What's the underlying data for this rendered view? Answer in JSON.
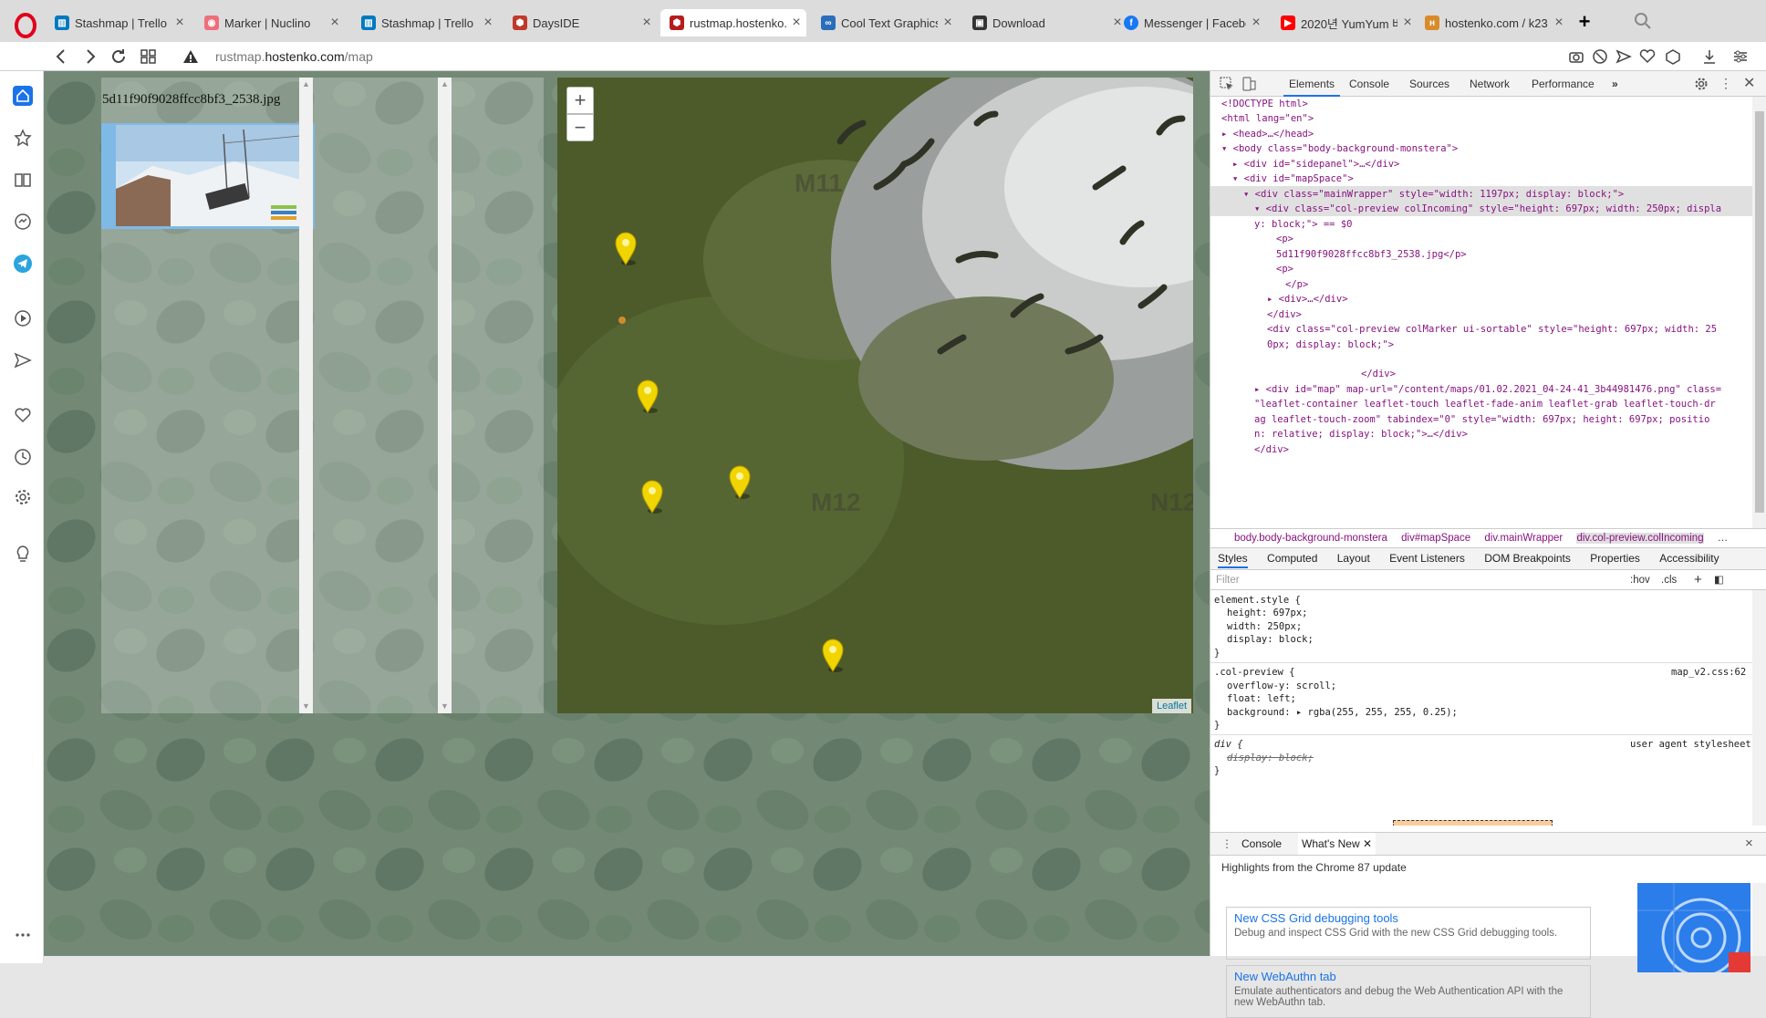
{
  "tabs": [
    {
      "title": "Stashmap | Trello",
      "fav": "trello",
      "color": "#0079bf"
    },
    {
      "title": "Marker | Nuclino",
      "fav": "nuclino",
      "color": "#ef6e7c"
    },
    {
      "title": "Stashmap | Trello",
      "fav": "trello",
      "color": "#0079bf"
    },
    {
      "title": "DaysIDE",
      "fav": "dayside",
      "color": "#c0392b"
    },
    {
      "title": "rustmap.hostenko.co",
      "fav": "rustmap",
      "color": "#b71c1c",
      "active": true
    },
    {
      "title": "Cool Text Graphics G",
      "fav": "cooltext",
      "color": "#2a6ebb"
    },
    {
      "title": "Download",
      "fav": "download",
      "color": "#333333"
    },
    {
      "title": "Messenger | Facebo",
      "fav": "facebook",
      "color": "#1877f2"
    },
    {
      "title": "2020년 YumYum 버",
      "fav": "youtube",
      "color": "#ff0000"
    },
    {
      "title": "hostenko.com / k23",
      "fav": "hostenko",
      "color": "#d98b2b"
    }
  ],
  "address": {
    "prefix": "rustmap.",
    "domain": "hostenko.com",
    "path": "/map"
  },
  "sidebar": {
    "items": [
      "home-icon",
      "bookmarks-icon",
      "reading-list-icon",
      "messenger-icon",
      "telegram-icon",
      "player-icon",
      "send-icon",
      "heart-icon",
      "history-icon",
      "settings-icon",
      "lightbulb-icon",
      "more-icon"
    ]
  },
  "page": {
    "preview_filename": "5d11f90f9028ffcc8bf3_2538.jpg",
    "zoom_in": "+",
    "zoom_out": "−",
    "attribution": "Leaflet",
    "map_labels": [
      "M11",
      "M12",
      "N12"
    ]
  },
  "devtools": {
    "tabs": [
      "Elements",
      "Console",
      "Sources",
      "Network",
      "Performance"
    ],
    "dom": {
      "doctype": "<!DOCTYPE html>",
      "html_open": "<html lang=\"en\">",
      "head": "<head>…</head>",
      "body_open": "<body class=\"body-background-monstera\">",
      "sidepanel": "<div id=\"sidepanel\">…</div>",
      "mapspace": "<div id=\"mapSpace\">",
      "mainwrapper": "<div class=\"mainWrapper\" style=\"width: 1197px; display: block;\">",
      "incoming_1": "<div class=\"col-preview colIncoming\" style=\"height: 697px; width: 250px; displa",
      "incoming_2": "y: block;\"> == $0",
      "p_open": "<p>",
      "p_text": "5d11f90f9028ffcc8bf3_2538.jpg</p>",
      "p_open2": "<p>",
      "p_close": "</p>",
      "div_collapsed": "<div>…</div>",
      "div_close": "</div>",
      "marker_1": "<div class=\"col-preview colMarker ui-sortable\" style=\"height: 697px; width: 25",
      "marker_2": "0px; display: block;\">",
      "div_close2": "</div>",
      "map_1": "<div id=\"map\" map-url=\"/content/maps/01.02.2021_04-24-41_3b44981476.png\" class=",
      "map_2": "\"leaflet-container leaflet-touch leaflet-fade-anim leaflet-grab leaflet-touch-dr",
      "map_3": "ag leaflet-touch-zoom\" tabindex=\"0\" style=\"width: 697px; height: 697px; positio",
      "map_4": "n: relative; display: block;\">…</div>",
      "div_close3": "</div>"
    },
    "breadcrumbs": [
      "body.body-background-monstera",
      "div#mapSpace",
      "div.mainWrapper",
      "div.col-preview.colIncoming",
      "…"
    ],
    "subtabs": [
      "Styles",
      "Computed",
      "Layout",
      "Event Listeners",
      "DOM Breakpoints",
      "Properties",
      "Accessibility"
    ],
    "filter_placeholder": "Filter",
    "hov": ":hov",
    "cls": ".cls",
    "styles": {
      "element_style": "element.style {",
      "height": "height: 697px;",
      "width": "width: 250px;",
      "display": "display: block;",
      "close": "}",
      "col_preview": ".col-preview {",
      "col_preview_src": "map_v2.css:62",
      "overflow": "overflow-y: scroll;",
      "float": "float: left;",
      "background": "background: ▸ rgba(255, 255, 255, 0.25);",
      "close2": "}",
      "div_sel": "div {",
      "ua": "user agent stylesheet",
      "display_strike": "display: block;",
      "close3": "}"
    },
    "drawer": {
      "tabs": [
        "Console",
        "What's New"
      ],
      "close": "×"
    },
    "whats_new": {
      "header": "Highlights from the Chrome 87 update",
      "cards": [
        {
          "title": "New CSS Grid debugging tools",
          "desc": "Debug and inspect CSS Grid with the new CSS Grid debugging tools."
        },
        {
          "title": "New WebAuthn tab",
          "desc": "Emulate authenticators and debug the Web Authentication API with the new WebAuthn tab."
        }
      ]
    }
  }
}
